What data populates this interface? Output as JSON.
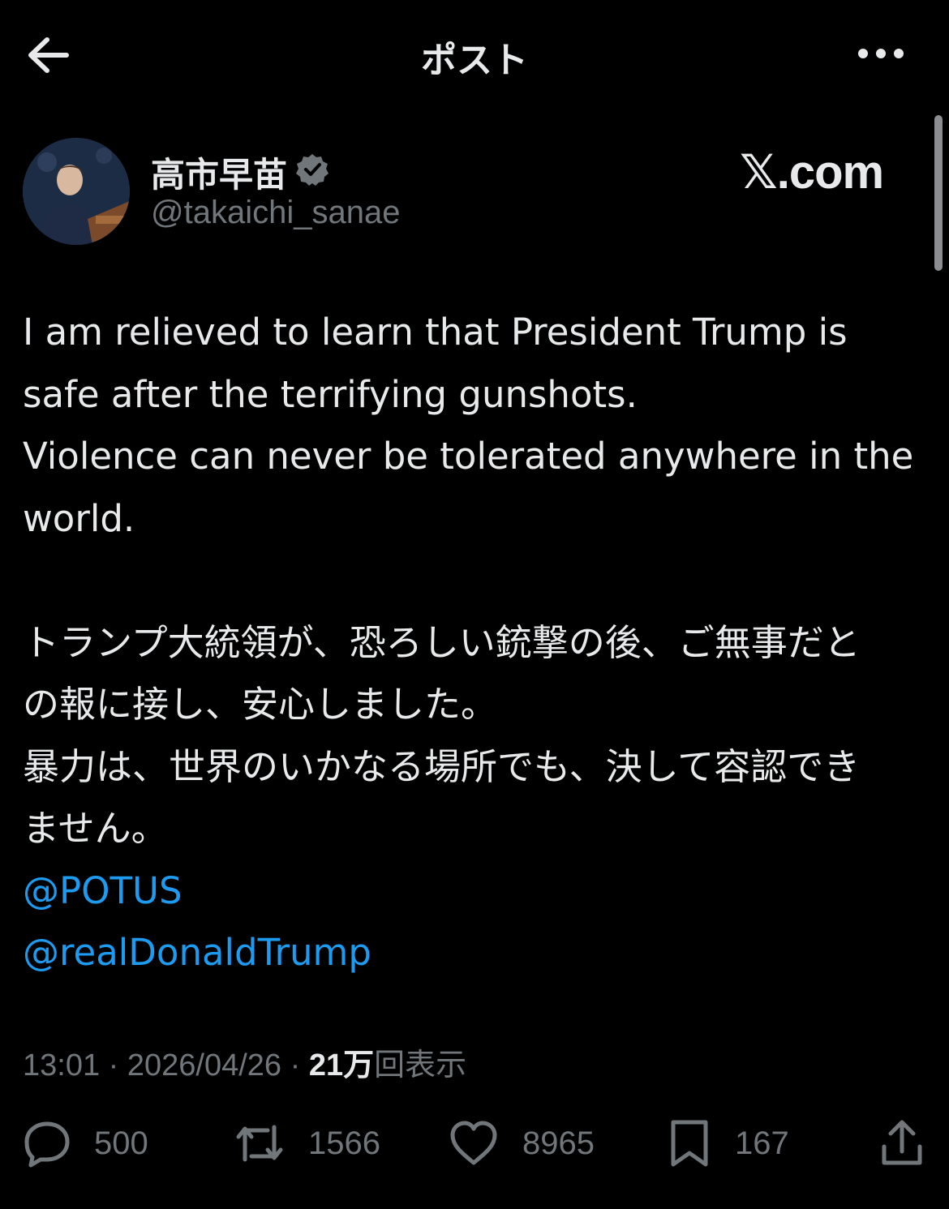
{
  "header": {
    "title": "ポスト",
    "back_icon": "arrow-left-icon",
    "more_icon": "more-horizontal-icon"
  },
  "author": {
    "display_name": "高市早苗",
    "handle": "@takaichi_sanae",
    "verified": true,
    "verified_color": "#71767b"
  },
  "watermark": "𝕏.com",
  "tweet": {
    "lines": [
      "I am relieved to learn that President Trump is",
      "safe after the terrifying gunshots.",
      "Violence can never be tolerated anywhere in the",
      "world.",
      "",
      "トランプ大統領が、恐ろしい銃撃の後、ご無事だと",
      "の報に接し、安心しました。",
      "暴力は、世界のいかなる場所でも、決して容認でき",
      "ません。"
    ],
    "mentions": [
      "@POTUS",
      "@realDonaldTrump"
    ]
  },
  "meta": {
    "time": "13:01",
    "separator": "·",
    "date": "2026/04/26",
    "views_count": "21万",
    "views_label": "回表示"
  },
  "actions": {
    "replies": "500",
    "reposts": "1566",
    "likes": "8965",
    "bookmarks": "167"
  },
  "colors": {
    "background": "#000000",
    "text": "#e7e9ea",
    "secondary": "#71767b",
    "link": "#1d9bf0"
  }
}
